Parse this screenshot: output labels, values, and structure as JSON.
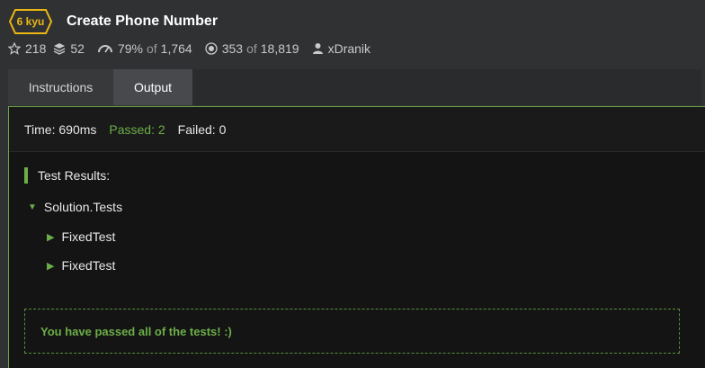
{
  "kata": {
    "rank": "6 kyu",
    "title": "Create Phone Number"
  },
  "stats": {
    "stars": "218",
    "collections": "52",
    "satisfaction": "79%",
    "satisfaction_of": "of",
    "satisfaction_total": "1,764",
    "completed": "353",
    "completed_of": "of",
    "completed_total": "18,819",
    "author": "xDranik"
  },
  "tabs": [
    {
      "label": "Instructions",
      "active": false
    },
    {
      "label": "Output",
      "active": true
    }
  ],
  "output": {
    "time": "Time: 690ms",
    "passed": "Passed: 2",
    "failed": "Failed: 0",
    "results_heading": "Test Results:",
    "suite": "Solution.Tests",
    "tests": [
      "FixedTest",
      "FixedTest"
    ],
    "pass_message": "You have passed all of the tests! :)"
  },
  "colors": {
    "rank": "#ecb613",
    "pass": "#6cae48"
  }
}
